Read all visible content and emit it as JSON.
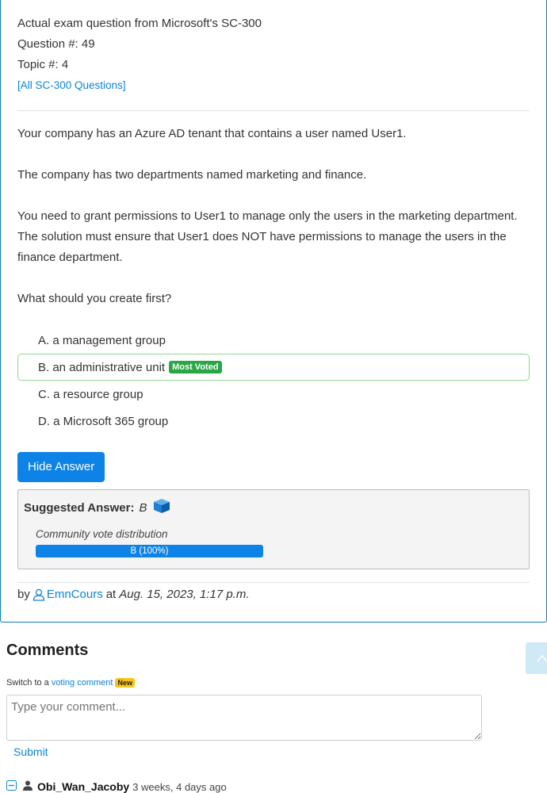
{
  "question": {
    "exam_line": "Actual exam question from Microsoft's SC-300",
    "number_line": "Question #: 49",
    "topic_line": "Topic #: 4",
    "all_link": "[All SC-300 Questions]",
    "paragraphs": [
      "Your company has an Azure AD tenant that contains a user named User1.",
      "The company has two departments named marketing and finance.",
      "You need to grant permissions to User1 to manage only the users in the marketing department. The solution must ensure that User1 does NOT have permissions to manage the users in the finance department.",
      "What should you create first?"
    ],
    "choices": [
      {
        "label": "A. a management group"
      },
      {
        "label": "B. an administrative unit",
        "badge": "Most Voted"
      },
      {
        "label": "C. a resource group"
      },
      {
        "label": "D. a Microsoft 365 group"
      }
    ],
    "hide_button": "Hide Answer",
    "suggested_label": "Suggested Answer:",
    "suggested_value": "B",
    "vote_label": "Community vote distribution",
    "vote_bar": {
      "text": "B (100%)",
      "percent": 100
    },
    "author": {
      "by": "by",
      "name": "EmnCours",
      "at": "at",
      "date": "Aug. 15, 2023, 1:17 p.m."
    }
  },
  "comments": {
    "title": "Comments",
    "switch_text": "Switch to a",
    "voting_link": "voting comment",
    "new_badge": "New",
    "placeholder": "Type your comment...",
    "submit": "Submit",
    "first": {
      "name": "Obi_Wan_Jacoby",
      "ago": "3 weeks, 4 days ago"
    }
  },
  "colors": {
    "accent": "#0d83e8",
    "voted_badge": "#28a745",
    "new_badge": "#f5c518"
  },
  "icons": {
    "cube": "cube-icon",
    "user": "user-icon",
    "scroll": "chevron-up-icon",
    "collapse": "collapse-icon",
    "person": "person-icon"
  }
}
